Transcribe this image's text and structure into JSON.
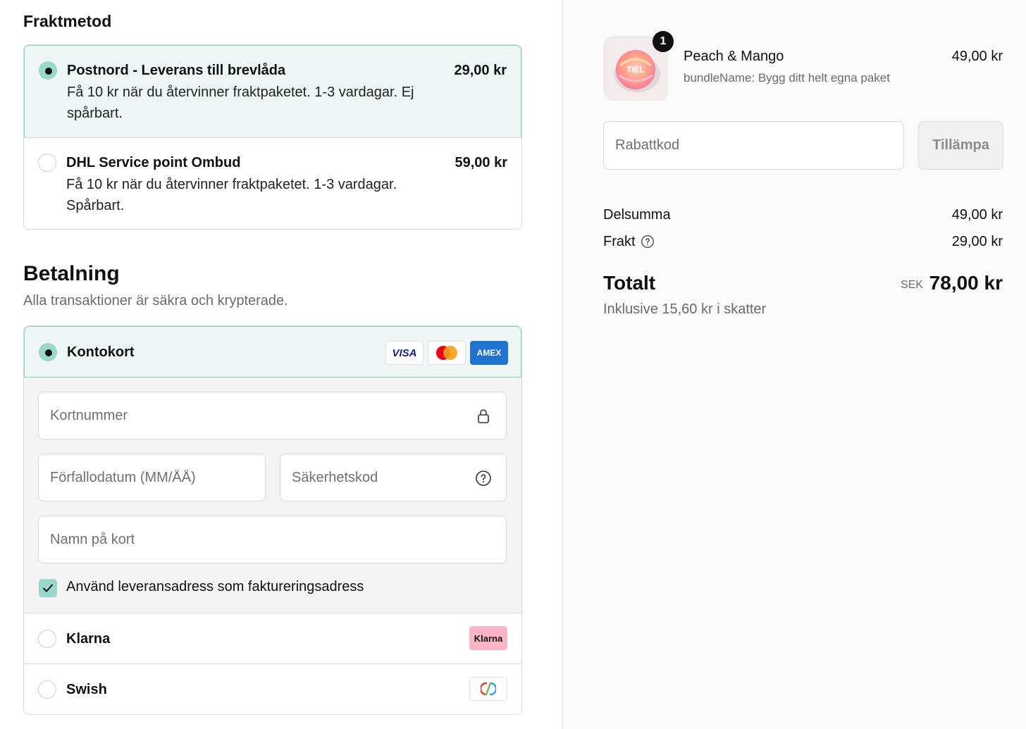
{
  "shipping": {
    "title": "Fraktmetod",
    "options": [
      {
        "name": "Postnord - Leverans till brevlåda",
        "price": "29,00 kr",
        "desc_line1": "Få 10 kr när du återvinner fraktpaketet. 1-3 vardagar. Ej",
        "desc_line2": "spårbart.",
        "selected": true
      },
      {
        "name": "DHL Service point Ombud",
        "price": "59,00 kr",
        "desc_line1": "Få 10 kr när du återvinner fraktpaketet. 1-3 vardagar.",
        "desc_line2": "Spårbart.",
        "selected": false
      }
    ]
  },
  "payment": {
    "title": "Betalning",
    "subtitle": "Alla transaktioner är säkra och krypterade.",
    "card": {
      "label": "Kontokort",
      "brands": [
        "VISA",
        "Mastercard",
        "AMEX"
      ],
      "fields": {
        "number_placeholder": "Kortnummer",
        "expiry_placeholder": "Förfallodatum (MM/ÅÅ)",
        "cvc_placeholder": "Säkerhetskod",
        "name_placeholder": "Namn på kort"
      },
      "billing_checkbox_label": "Använd leveransadress som faktureringsadress"
    },
    "klarna": {
      "label": "Klarna",
      "logo_text": "Klarna"
    },
    "swish": {
      "label": "Swish"
    }
  },
  "summary": {
    "product": {
      "name": "Peach & Mango",
      "bundle": "bundleName: Bygg ditt helt egna paket",
      "price": "49,00 kr",
      "quantity": "1",
      "thumb_text": "TIEL"
    },
    "discount": {
      "placeholder": "Rabattkod",
      "apply_label": "Tillämpa"
    },
    "subtotal_label": "Delsumma",
    "subtotal_value": "49,00 kr",
    "shipping_label": "Frakt",
    "shipping_value": "29,00 kr",
    "total_label": "Totalt",
    "currency": "SEK",
    "total_value": "78,00 kr",
    "tax_note": "Inklusive 15,60 kr i skatter"
  },
  "colors": {
    "selected_bg": "#eef7f5",
    "selected_border": "#8fcfc3",
    "accent": "#9ad6c9",
    "amex": "#1f72cd",
    "klarna_pink": "#ffb3c7"
  }
}
